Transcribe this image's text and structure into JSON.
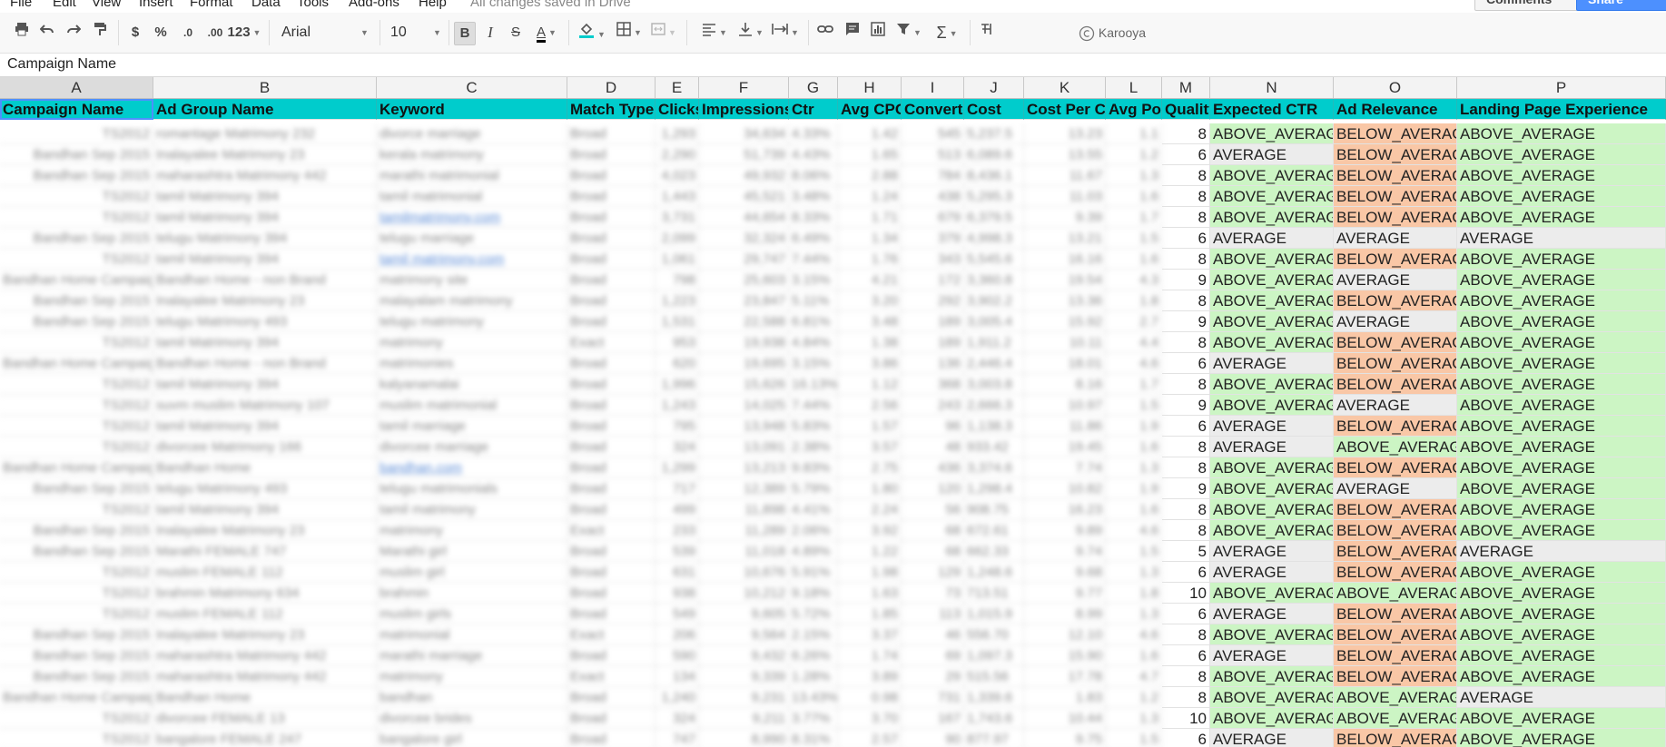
{
  "menu": [
    "File",
    "Edit",
    "View",
    "Insert",
    "Format",
    "Data",
    "Tools",
    "Add-ons",
    "Help"
  ],
  "saved_status": "All changes saved in Drive",
  "buttons": {
    "comments": "Comments",
    "share": "Share"
  },
  "toolbar": {
    "currency": "$",
    "percent": "%",
    "dec_decrease": ".0",
    "dec_increase": ".00",
    "more_formats": "123",
    "font": "Arial",
    "font_size": "10",
    "bold": "B",
    "italic": "I",
    "strikethrough": "S",
    "text_color": "A",
    "sigma": "Σ",
    "addon_label": "Karooya"
  },
  "formula_bar": {
    "value": "Campaign Name"
  },
  "columns": [
    "A",
    "B",
    "C",
    "D",
    "E",
    "F",
    "G",
    "H",
    "I",
    "J",
    "K",
    "L",
    "M",
    "N",
    "O",
    "P"
  ],
  "header_row": [
    "Campaign Name",
    "Ad Group Name",
    "Keyword",
    "Match Type",
    "Clicks",
    "Impressions",
    "Ctr",
    "Avg CPC",
    "Converted",
    "Cost",
    "Cost Per Conversion",
    "Avg Position",
    "Quality",
    "Expected CTR",
    "Ad Relevance",
    "Landing Page Experience"
  ],
  "colors": {
    "header_bg": "#00cccc",
    "above_average": "#ccf5c4",
    "below_average": "#f9c7a6",
    "average": "#ececec"
  },
  "rows": [
    {
      "a": "TS2012",
      "b": "romantage Matrimony 232",
      "c": "divorce marriage",
      "d": "Broad",
      "e": "1,293",
      "f": "34,634",
      "g": "4.33%",
      "h": "1.42",
      "i": "545",
      "j": "5,237.5",
      "k": "13.23",
      "l": "1.1",
      "q": "8",
      "ctr": "ABOVE_AVERAGE",
      "rel": "BELOW_AVERAGE",
      "lp": "ABOVE_AVERAGE"
    },
    {
      "a": "Bandhan Sep 2015",
      "b": "Inalayalee Matrimony 23",
      "c": "kerala matrimony",
      "d": "Broad",
      "e": "2,290",
      "f": "51,739",
      "g": "4.43%",
      "h": "1.65",
      "i": "513",
      "j": "6,089.6",
      "k": "13.55",
      "l": "1.2",
      "q": "6",
      "ctr": "AVERAGE",
      "rel": "BELOW_AVERAGE",
      "lp": "ABOVE_AVERAGE"
    },
    {
      "a": "Bandhan Sep 2015",
      "b": "maharashtra Matrimony 442",
      "c": "marathi matrimonial",
      "d": "Broad",
      "e": "4,023",
      "f": "49,932",
      "g": "8.06%",
      "h": "2.88",
      "i": "784",
      "j": "8,436.1",
      "k": "11.67",
      "l": "1.3",
      "q": "8",
      "ctr": "ABOVE_AVERAGE",
      "rel": "BELOW_AVERAGE",
      "lp": "ABOVE_AVERAGE"
    },
    {
      "a": "TS2012",
      "b": "tamil Matrimony 394",
      "c": "tamil matrimonial",
      "d": "Broad",
      "e": "1,443",
      "f": "45,521",
      "g": "3.48%",
      "h": "1.24",
      "i": "438",
      "j": "5,295.3",
      "k": "11.03",
      "l": "1.6",
      "q": "8",
      "ctr": "ABOVE_AVERAGE",
      "rel": "BELOW_AVERAGE",
      "lp": "ABOVE_AVERAGE"
    },
    {
      "a": "TS2012",
      "b": "tamil Matrimony 394",
      "c": "tamilmatrimony.com",
      "d": "Broad",
      "e": "3,731",
      "f": "44,654",
      "g": "8.33%",
      "h": "1.71",
      "i": "679",
      "j": "6,379.5",
      "k": "9.39",
      "l": "1.7",
      "q": "8",
      "ctr": "ABOVE_AVERAGE",
      "rel": "BELOW_AVERAGE",
      "lp": "ABOVE_AVERAGE"
    },
    {
      "a": "Bandhan Sep 2015",
      "b": "telugu Matrimony 394",
      "c": "telugu marriage",
      "d": "Broad",
      "e": "2,099",
      "f": "32,324",
      "g": "6.49%",
      "h": "1.34",
      "i": "379",
      "j": "4,998.3",
      "k": "13.21",
      "l": "1.5",
      "q": "6",
      "ctr": "AVERAGE",
      "rel": "AVERAGE",
      "lp": "AVERAGE"
    },
    {
      "a": "TS2012",
      "b": "tamil Matrimony 394",
      "c": "tamil matrimony.com",
      "d": "Broad",
      "e": "1,061",
      "f": "29,747",
      "g": "7.44%",
      "h": "1.76",
      "i": "343",
      "j": "5,545.6",
      "k": "16.16",
      "l": "1.6",
      "q": "8",
      "ctr": "ABOVE_AVERAGE",
      "rel": "BELOW_AVERAGE",
      "lp": "ABOVE_AVERAGE"
    },
    {
      "a": "Bandhan Home Campaign",
      "b": "Bandhan Home - non Brand",
      "c": "matrimony site",
      "d": "Broad",
      "e": "798",
      "f": "25,603",
      "g": "3.15%",
      "h": "4.21",
      "i": "172",
      "j": "3,360.8",
      "k": "19.54",
      "l": "4.3",
      "q": "9",
      "ctr": "ABOVE_AVERAGE",
      "rel": "AVERAGE",
      "lp": "ABOVE_AVERAGE"
    },
    {
      "a": "Bandhan Sep 2015",
      "b": "Inalayalee Matrimony 23",
      "c": "malayalam matrimony",
      "d": "Broad",
      "e": "1,223",
      "f": "23,847",
      "g": "5.11%",
      "h": "3.20",
      "i": "292",
      "j": "3,902.2",
      "k": "13.36",
      "l": "1.8",
      "q": "8",
      "ctr": "ABOVE_AVERAGE",
      "rel": "BELOW_AVERAGE",
      "lp": "ABOVE_AVERAGE"
    },
    {
      "a": "Bandhan Sep 2015",
      "b": "telugu Matrimony 493",
      "c": "telugu matrimony",
      "d": "Broad",
      "e": "1,531",
      "f": "22,588",
      "g": "6.81%",
      "h": "3.48",
      "i": "189",
      "j": "3,005.4",
      "k": "15.92",
      "l": "2.7",
      "q": "9",
      "ctr": "ABOVE_AVERAGE",
      "rel": "AVERAGE",
      "lp": "ABOVE_AVERAGE"
    },
    {
      "a": "TS2012",
      "b": "tamil Matrimony 394",
      "c": "matrimony",
      "d": "Exact",
      "e": "953",
      "f": "19,938",
      "g": "4.84%",
      "h": "1.38",
      "i": "189",
      "j": "1,911.2",
      "k": "10.11",
      "l": "4.4",
      "q": "8",
      "ctr": "ABOVE_AVERAGE",
      "rel": "BELOW_AVERAGE",
      "lp": "ABOVE_AVERAGE"
    },
    {
      "a": "Bandhan Home Campaign",
      "b": "Bandhan Home - non Brand",
      "c": "matrimonies",
      "d": "Broad",
      "e": "620",
      "f": "19,695",
      "g": "3.15%",
      "h": "3.86",
      "i": "136",
      "j": "2,446.4",
      "k": "18.01",
      "l": "4.6",
      "q": "6",
      "ctr": "AVERAGE",
      "rel": "BELOW_AVERAGE",
      "lp": "ABOVE_AVERAGE"
    },
    {
      "a": "TS2012",
      "b": "tamil Matrimony 394",
      "c": "kalyanamalai",
      "d": "Broad",
      "e": "1,996",
      "f": "15,626",
      "g": "16.13%",
      "h": "1.12",
      "i": "368",
      "j": "3,003.8",
      "k": "8.16",
      "l": "1.7",
      "q": "8",
      "ctr": "ABOVE_AVERAGE",
      "rel": "BELOW_AVERAGE",
      "lp": "ABOVE_AVERAGE"
    },
    {
      "a": "TS2012",
      "b": "suvm muslim Matrimony 107",
      "c": "muslim matrimonial",
      "d": "Broad",
      "e": "1,243",
      "f": "14,025",
      "g": "7.44%",
      "h": "2.56",
      "i": "243",
      "j": "2,666.3",
      "k": "10.97",
      "l": "1.5",
      "q": "9",
      "ctr": "ABOVE_AVERAGE",
      "rel": "AVERAGE",
      "lp": "ABOVE_AVERAGE"
    },
    {
      "a": "TS2012",
      "b": "tamil Matrimony 394",
      "c": "tamil marriage",
      "d": "Broad",
      "e": "795",
      "f": "13,948",
      "g": "5.83%",
      "h": "1.57",
      "i": "96",
      "j": "1,138.3",
      "k": "11.86",
      "l": "1.9",
      "q": "6",
      "ctr": "AVERAGE",
      "rel": "BELOW_AVERAGE",
      "lp": "ABOVE_AVERAGE"
    },
    {
      "a": "TS2012",
      "b": "divorcee Matrimony 166",
      "c": "divorcee marriage",
      "d": "Broad",
      "e": "324",
      "f": "13,091",
      "g": "2.38%",
      "h": "3.57",
      "i": "48",
      "j": "933.42",
      "k": "19.45",
      "l": "1.6",
      "q": "8",
      "ctr": "AVERAGE",
      "rel": "ABOVE_AVERAGE",
      "lp": "ABOVE_AVERAGE"
    },
    {
      "a": "Bandhan Home Campaign",
      "b": "Bandhan Home",
      "c": "bandhan.com",
      "d": "Broad",
      "e": "1,299",
      "f": "13,213",
      "g": "9.83%",
      "h": "2.75",
      "i": "436",
      "j": "3,374.6",
      "k": "7.74",
      "l": "1.3",
      "q": "8",
      "ctr": "ABOVE_AVERAGE",
      "rel": "BELOW_AVERAGE",
      "lp": "ABOVE_AVERAGE"
    },
    {
      "a": "Bandhan Sep 2015",
      "b": "telugu Matrimony 493",
      "c": "telugu matrimonials",
      "d": "Broad",
      "e": "717",
      "f": "12,389",
      "g": "5.79%",
      "h": "1.80",
      "i": "120",
      "j": "1,298.4",
      "k": "10.82",
      "l": "1.9",
      "q": "9",
      "ctr": "ABOVE_AVERAGE",
      "rel": "AVERAGE",
      "lp": "ABOVE_AVERAGE"
    },
    {
      "a": "TS2012",
      "b": "tamil Matrimony 394",
      "c": "tamil matrimony",
      "d": "Broad",
      "e": "499",
      "f": "11,898",
      "g": "4.41%",
      "h": "2.24",
      "i": "56",
      "j": "908.75",
      "k": "16.23",
      "l": "1.6",
      "q": "8",
      "ctr": "ABOVE_AVERAGE",
      "rel": "BELOW_AVERAGE",
      "lp": "ABOVE_AVERAGE"
    },
    {
      "a": "Bandhan Sep 2015",
      "b": "Inalayalee Matrimony 23",
      "c": "matrimony",
      "d": "Exact",
      "e": "233",
      "f": "11,289",
      "g": "2.06%",
      "h": "3.92",
      "i": "68",
      "j": "672.61",
      "k": "9.89",
      "l": "4.6",
      "q": "8",
      "ctr": "ABOVE_AVERAGE",
      "rel": "BELOW_AVERAGE",
      "lp": "ABOVE_AVERAGE"
    },
    {
      "a": "Bandhan Sep 2015",
      "b": "Marathi FEMALE 747",
      "c": "Marathi girl",
      "d": "Broad",
      "e": "539",
      "f": "11,018",
      "g": "4.89%",
      "h": "1.22",
      "i": "68",
      "j": "662.33",
      "k": "9.74",
      "l": "1.5",
      "q": "5",
      "ctr": "AVERAGE",
      "rel": "BELOW_AVERAGE",
      "lp": "AVERAGE"
    },
    {
      "a": "TS2012",
      "b": "muslim FEMALE 112",
      "c": "muslim girl",
      "d": "Broad",
      "e": "631",
      "f": "10,676",
      "g": "5.91%",
      "h": "1.98",
      "i": "129",
      "j": "1,248.6",
      "k": "9.68",
      "l": "1.3",
      "q": "6",
      "ctr": "AVERAGE",
      "rel": "BELOW_AVERAGE",
      "lp": "ABOVE_AVERAGE"
    },
    {
      "a": "TS2012",
      "b": "brahmin Matrimony 634",
      "c": "brahmin",
      "d": "Broad",
      "e": "938",
      "f": "10,212",
      "g": "9.18%",
      "h": "1.63",
      "i": "73",
      "j": "713.51",
      "k": "9.77",
      "l": "1.8",
      "q": "10",
      "ctr": "ABOVE_AVERAGE",
      "rel": "ABOVE_AVERAGE",
      "lp": "ABOVE_AVERAGE"
    },
    {
      "a": "TS2012",
      "b": "muslim FEMALE 112",
      "c": "muslim girls",
      "d": "Broad",
      "e": "549",
      "f": "9,605",
      "g": "5.72%",
      "h": "1.85",
      "i": "113",
      "j": "1,015.9",
      "k": "8.99",
      "l": "1.3",
      "q": "6",
      "ctr": "AVERAGE",
      "rel": "BELOW_AVERAGE",
      "lp": "ABOVE_AVERAGE"
    },
    {
      "a": "Bandhan Sep 2015",
      "b": "Inalayalee Matrimony 23",
      "c": "matrimonial",
      "d": "Exact",
      "e": "206",
      "f": "9,564",
      "g": "2.15%",
      "h": "3.37",
      "i": "46",
      "j": "556.70",
      "k": "12.10",
      "l": "4.6",
      "q": "8",
      "ctr": "ABOVE_AVERAGE",
      "rel": "BELOW_AVERAGE",
      "lp": "ABOVE_AVERAGE"
    },
    {
      "a": "Bandhan Sep 2015",
      "b": "maharashtra Matrimony 442",
      "c": "marathi marriage",
      "d": "Broad",
      "e": "590",
      "f": "9,432",
      "g": "6.26%",
      "h": "1.74",
      "i": "69",
      "j": "1,097.3",
      "k": "15.90",
      "l": "1.6",
      "q": "6",
      "ctr": "AVERAGE",
      "rel": "BELOW_AVERAGE",
      "lp": "ABOVE_AVERAGE"
    },
    {
      "a": "Bandhan Sep 2015",
      "b": "maharashtra Matrimony 442",
      "c": "matrimony",
      "d": "Exact",
      "e": "134",
      "f": "9,339",
      "g": "1.28%",
      "h": "3.89",
      "i": "29",
      "j": "515.56",
      "k": "17.78",
      "l": "4.7",
      "q": "8",
      "ctr": "ABOVE_AVERAGE",
      "rel": "BELOW_AVERAGE",
      "lp": "ABOVE_AVERAGE"
    },
    {
      "a": "Bandhan Home Campaign",
      "b": "Bandhan Home",
      "c": "bandhan",
      "d": "Broad",
      "e": "1,240",
      "f": "9,231",
      "g": "13.43%",
      "h": "0.98",
      "i": "731",
      "j": "1,339.6",
      "k": "1.83",
      "l": "1.2",
      "q": "8",
      "ctr": "ABOVE_AVERAGE",
      "rel": "ABOVE_AVERAGE",
      "lp": "AVERAGE"
    },
    {
      "a": "TS2012",
      "b": "divorcee FEMALE 13",
      "c": "divorcee brides",
      "d": "Broad",
      "e": "324",
      "f": "9,211",
      "g": "3.77%",
      "h": "3.70",
      "i": "167",
      "j": "1,743.6",
      "k": "10.44",
      "l": "1.3",
      "q": "10",
      "ctr": "ABOVE_AVERAGE",
      "rel": "ABOVE_AVERAGE",
      "lp": "ABOVE_AVERAGE"
    },
    {
      "a": "TS2012",
      "b": "bangalore FEMALE 247",
      "c": "bangalore girl",
      "d": "Broad",
      "e": "747",
      "f": "8,990",
      "g": "8.31%",
      "h": "2.57",
      "i": "90",
      "j": "877.97",
      "k": "9.75",
      "l": "1.5",
      "q": "6",
      "ctr": "AVERAGE",
      "rel": "BELOW_AVERAGE",
      "lp": "ABOVE_AVERAGE"
    }
  ]
}
